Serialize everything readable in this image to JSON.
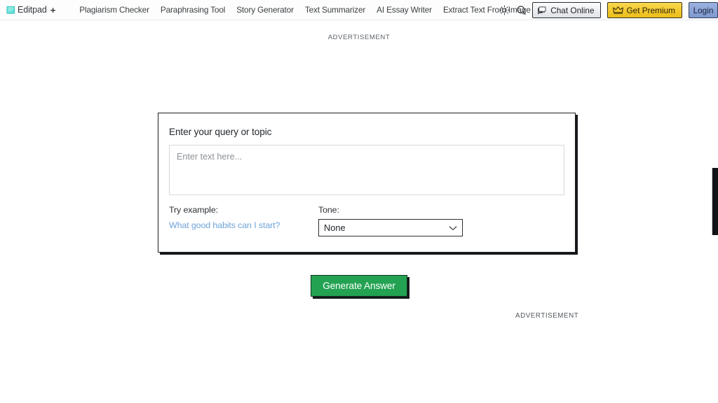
{
  "header": {
    "brand": {
      "icon": "notepad-icon",
      "name": "Editpad",
      "plus": "+"
    },
    "nav_items": [
      {
        "label": "Plagiarism Checker"
      },
      {
        "label": "Paraphrasing Tool"
      },
      {
        "label": "Story Generator"
      },
      {
        "label": "Text Summarizer"
      },
      {
        "label": "AI Essay Writer"
      },
      {
        "label": "Extract Text From Image"
      }
    ],
    "theme_toggle_icon": "sun-icon",
    "search_icon": "search-icon",
    "chat_button": {
      "label": "Chat Online",
      "icon": "chat-bubbles-icon",
      "bg": "#eceef1"
    },
    "premium_button": {
      "label": "Get Premium",
      "icon": "crown-icon",
      "bg": "#f2c82e"
    },
    "login_button": {
      "label": "Login",
      "bg": "#8aa3d6"
    }
  },
  "ads": {
    "top_label": "ADVERTISEMENT",
    "bottom_label": "ADVERTISEMENT"
  },
  "main": {
    "card_title": "Enter your query or topic",
    "query_input": {
      "value": "",
      "placeholder": "Enter text here..."
    },
    "example": {
      "label": "Try example:",
      "link_text": "What good habits can I start?",
      "link_color": "#6ea3d8"
    },
    "tone": {
      "label": "Tone:",
      "selected": "None",
      "chevron_icon": "chevron-down-icon"
    },
    "generate_button": {
      "label": "Generate Answer",
      "bg": "#23a352"
    }
  },
  "scrollbar": {
    "name": "vertical-scrollbar-thumb",
    "color": "#111315"
  }
}
